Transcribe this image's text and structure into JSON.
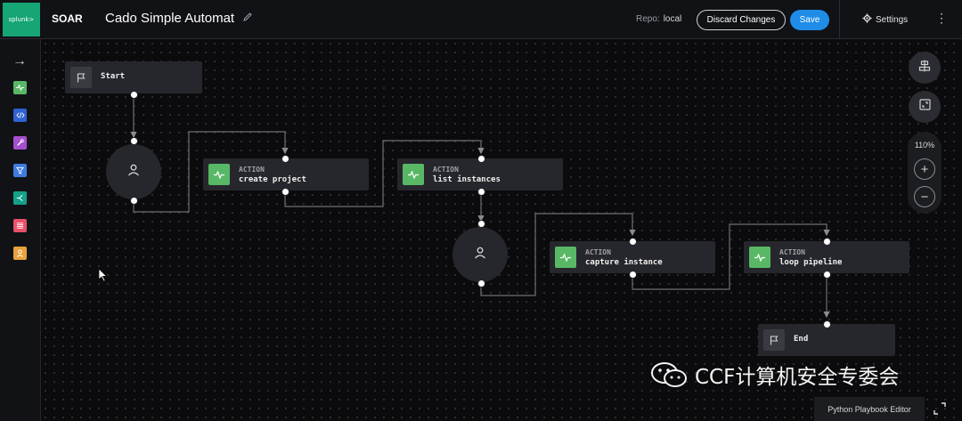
{
  "header": {
    "logo_text": "splunk>",
    "app_name": "SOAR",
    "playbook_title": "Cado Simple Automation",
    "repo_label": "Repo:",
    "repo_value": "local",
    "discard_label": "Discard Changes",
    "save_label": "Save",
    "settings_label": "Settings"
  },
  "toolbar": {
    "tools": [
      {
        "name": "action-tool",
        "color": "#58b866"
      },
      {
        "name": "code-tool",
        "color": "#2f62d3"
      },
      {
        "name": "utility-tool",
        "color": "#a64fd0"
      },
      {
        "name": "filter-tool",
        "color": "#3f7be0"
      },
      {
        "name": "decision-tool",
        "color": "#15a189"
      },
      {
        "name": "format-tool",
        "color": "#e8506a"
      },
      {
        "name": "prompt-tool",
        "color": "#e9a23b"
      }
    ]
  },
  "canvas": {
    "start": {
      "label": "Start"
    },
    "end": {
      "label": "End"
    },
    "actions": [
      {
        "kind": "ACTION",
        "name": "create project"
      },
      {
        "kind": "ACTION",
        "name": "list instances"
      },
      {
        "kind": "ACTION",
        "name": "capture instance"
      },
      {
        "kind": "ACTION",
        "name": "loop pipeline"
      }
    ]
  },
  "controls": {
    "zoom_level": "110%"
  },
  "footer": {
    "editor_label": "Python Playbook Editor"
  },
  "watermark": {
    "text": "CCF计算机安全专委会"
  },
  "colors": {
    "accent_blue": "#1f8ce8",
    "action_green": "#58b866",
    "node_bg": "#26272c",
    "brand_green": "#16a574"
  }
}
